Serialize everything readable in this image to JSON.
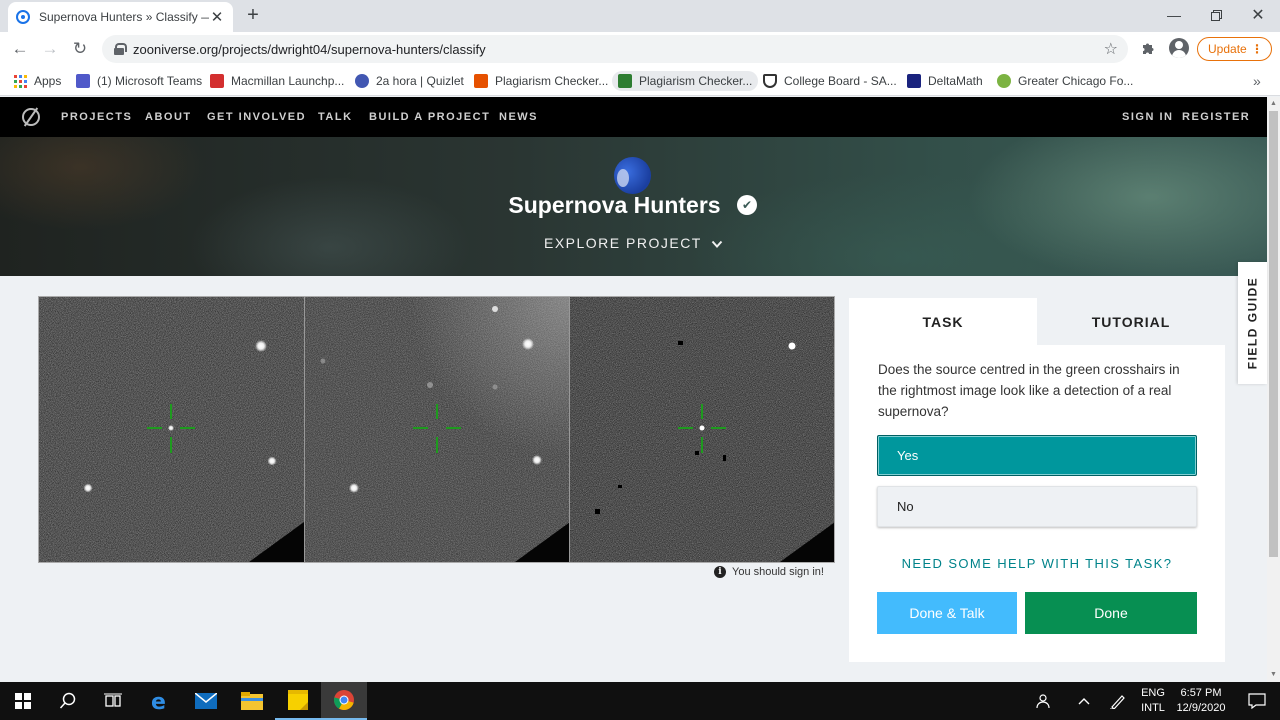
{
  "browser": {
    "tab_title": "Supernova Hunters » Classify — Zooniverse",
    "url": "zooniverse.org/projects/dwright04/supernova-hunters/classify",
    "update_label": "Update",
    "bookmarks": [
      {
        "label": "Apps",
        "color": "#4285f4"
      },
      {
        "label": "(1) Microsoft Teams",
        "color": "#5059c9"
      },
      {
        "label": "Macmillan Launchp...",
        "color": "#d32f2f"
      },
      {
        "label": "2a hora | Quizlet",
        "color": "#4257b2"
      },
      {
        "label": "Plagiarism Checker...",
        "color": "#e65100"
      },
      {
        "label": "Plagiarism Checker...",
        "color": "#2e7d32"
      },
      {
        "label": "College Board - SA...",
        "color": "#333333"
      },
      {
        "label": "DeltaMath",
        "color": "#1a237e"
      },
      {
        "label": "Greater Chicago Fo...",
        "color": "#7cb342"
      }
    ]
  },
  "zoo_nav": {
    "links": [
      "PROJECTS",
      "ABOUT",
      "GET INVOLVED",
      "TALK",
      "BUILD A PROJECT",
      "NEWS"
    ],
    "sign_in": "SIGN IN",
    "register": "REGISTER"
  },
  "hero": {
    "title": "Supernova Hunters",
    "explore": "EXPLORE PROJECT"
  },
  "viewer": {
    "signin_note": "You should sign in!"
  },
  "task": {
    "tabs": [
      "TASK",
      "TUTORIAL"
    ],
    "question": "Does the source centred in the green crosshairs in the rightmost image look like a detection of a real supernova?",
    "answers": [
      "Yes",
      "No"
    ],
    "help": "NEED SOME HELP WITH THIS TASK?",
    "done_talk": "Done & Talk",
    "done": "Done",
    "field_guide": "FIELD GUIDE"
  },
  "taskbar": {
    "lang_top": "ENG",
    "lang_bottom": "INTL",
    "time": "6:57 PM",
    "date": "12/9/2020"
  },
  "colors": {
    "accent_teal": "#00979d",
    "done_green": "#078f52",
    "talk_blue": "#43bbfd"
  }
}
